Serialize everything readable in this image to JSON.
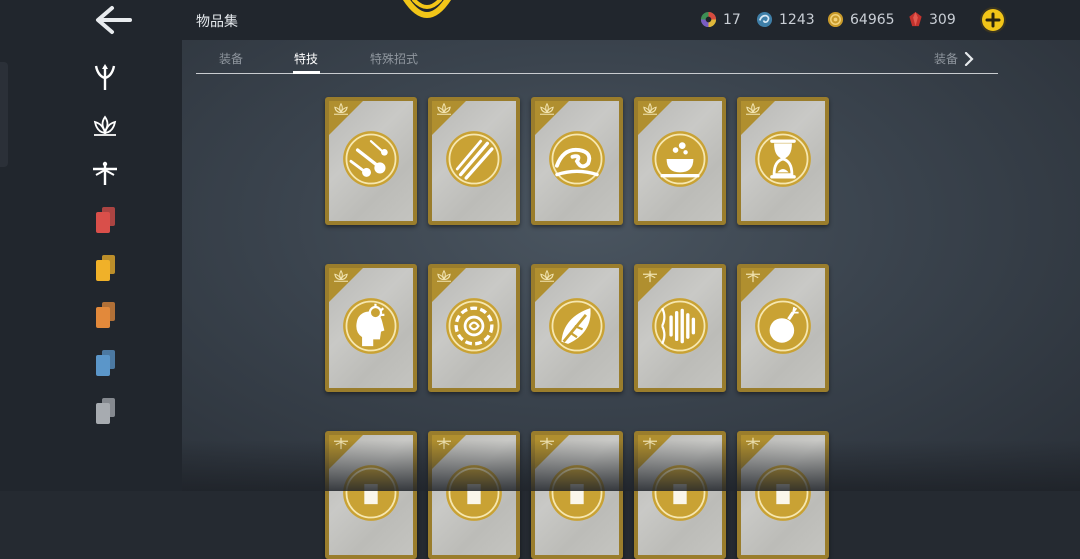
{
  "header": {
    "title": "物品集",
    "currencies": [
      {
        "name": "colorful-gem-icon",
        "value": "17"
      },
      {
        "name": "blue-swirl-icon",
        "value": "1243"
      },
      {
        "name": "gold-coin-icon",
        "value": "64965"
      },
      {
        "name": "red-gem-icon",
        "value": "309"
      }
    ]
  },
  "tabs": [
    {
      "label": "装备",
      "active": false
    },
    {
      "label": "特技",
      "active": true
    },
    {
      "label": "特殊招式",
      "active": false
    }
  ],
  "next_tab": {
    "label": "装备"
  },
  "sidebar": {
    "items": [
      {
        "icon": "trident-icon"
      },
      {
        "icon": "lotus-icon"
      },
      {
        "icon": "dragonfly-icon"
      },
      {
        "icon": "red-cards-icon",
        "color": "#d94f4a"
      },
      {
        "icon": "yellow-cards-icon",
        "color": "#f0b129"
      },
      {
        "icon": "orange-cards-icon",
        "color": "#e2893b"
      },
      {
        "icon": "blue-cards-icon",
        "color": "#5b96c9"
      },
      {
        "icon": "gray-cards-icon",
        "color": "#a7abb0"
      }
    ]
  },
  "colors": {
    "accent_gold": "#c9a234",
    "card_frame": "#9a7d2c"
  },
  "cards": [
    {
      "category": "lotus",
      "icon": "falling-stars-icon"
    },
    {
      "category": "lotus",
      "icon": "claw-slash-icon"
    },
    {
      "category": "lotus",
      "icon": "wave-icon"
    },
    {
      "category": "lotus",
      "icon": "teacup-icon"
    },
    {
      "category": "lotus",
      "icon": "hourglass-icon"
    },
    {
      "category": "lotus",
      "icon": "head-explosion-icon"
    },
    {
      "category": "lotus",
      "icon": "chain-ring-icon"
    },
    {
      "category": "lotus",
      "icon": "feather-shield-icon"
    },
    {
      "category": "dragonfly",
      "icon": "sound-wave-icon"
    },
    {
      "category": "dragonfly",
      "icon": "bomb-icon"
    },
    {
      "category": "dragonfly",
      "icon": "unknown-icon"
    },
    {
      "category": "dragonfly",
      "icon": "unknown-icon"
    },
    {
      "category": "dragonfly",
      "icon": "unknown-icon"
    },
    {
      "category": "dragonfly",
      "icon": "unknown-icon"
    },
    {
      "category": "dragonfly",
      "icon": "unknown-icon"
    }
  ]
}
